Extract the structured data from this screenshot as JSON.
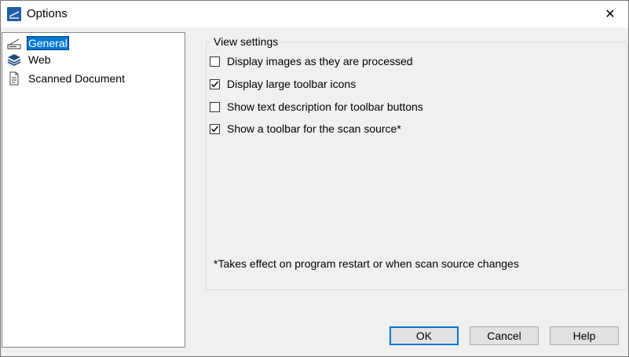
{
  "window": {
    "title": "Options",
    "close_glyph": "✕"
  },
  "tree": {
    "items": [
      {
        "label": "General",
        "icon": "scanner-icon",
        "selected": true
      },
      {
        "label": "Web",
        "icon": "layers-icon",
        "selected": false
      },
      {
        "label": "Scanned Document",
        "icon": "document-icon",
        "selected": false
      }
    ]
  },
  "view_settings": {
    "legend": "View settings",
    "options": [
      {
        "label": "Display images as they are processed",
        "checked": false
      },
      {
        "label": "Display large toolbar icons",
        "checked": true
      },
      {
        "label": "Show text description for toolbar buttons",
        "checked": false
      },
      {
        "label": "Show a toolbar for the scan source*",
        "checked": true
      }
    ],
    "note": "*Takes effect on program restart or when scan source changes"
  },
  "buttons": {
    "ok": "OK",
    "cancel": "Cancel",
    "help": "Help"
  },
  "colors": {
    "accent": "#0078d7",
    "app_icon": "#1f5fa8"
  }
}
